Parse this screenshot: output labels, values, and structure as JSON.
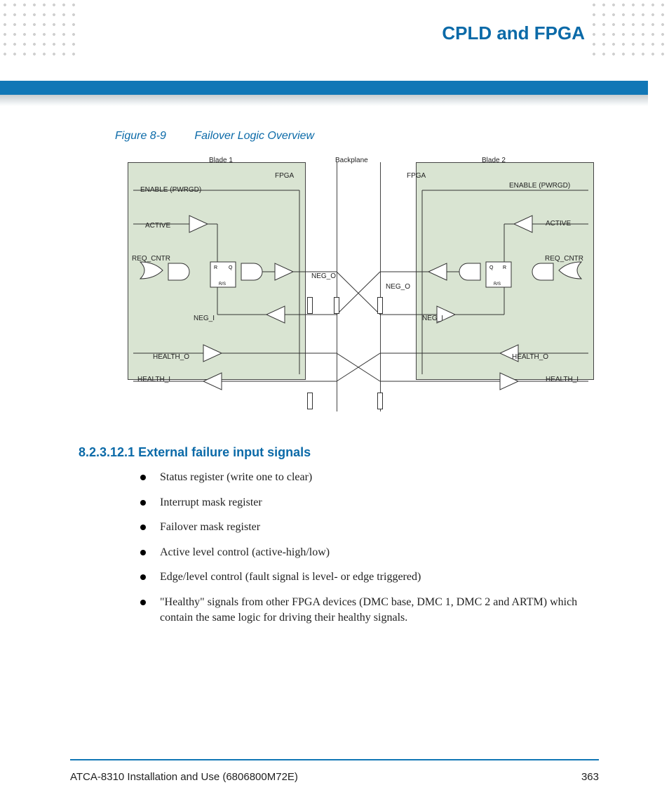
{
  "chapter_title": "CPLD and FPGA",
  "figure": {
    "number": "Figure 8-9",
    "title": "Failover Logic Overview"
  },
  "diagram_labels": {
    "blade1": "Blade 1",
    "blade2": "Blade 2",
    "backplane": "Backplane",
    "fpga": "FPGA",
    "enable": "ENABLE (PWRGD)",
    "active": "ACTIVE",
    "req_cntr": "REQ_CNTR",
    "neg_o": "NEG_O",
    "neg_i": "NEG_I",
    "health_o": "HEALTH_O",
    "health_i": "HEALTH_I",
    "ff_r": "R",
    "ff_q": "Q",
    "ff_rs": "R/S"
  },
  "section": {
    "number": "8.2.3.12.1",
    "title": "External failure input signals"
  },
  "bullets": [
    "Status register (write one to clear)",
    "Interrupt mask register",
    "Failover mask register",
    "Active level control (active-high/low)",
    "Edge/level control (fault signal is level- or edge triggered)",
    "\"Healthy\" signals from other FPGA devices (DMC base, DMC 1, DMC 2 and ARTM) which contain the same logic for driving their healthy signals."
  ],
  "footer": {
    "doc_title": "ATCA-8310 Installation and Use (6806800M72E)",
    "page": "363"
  }
}
